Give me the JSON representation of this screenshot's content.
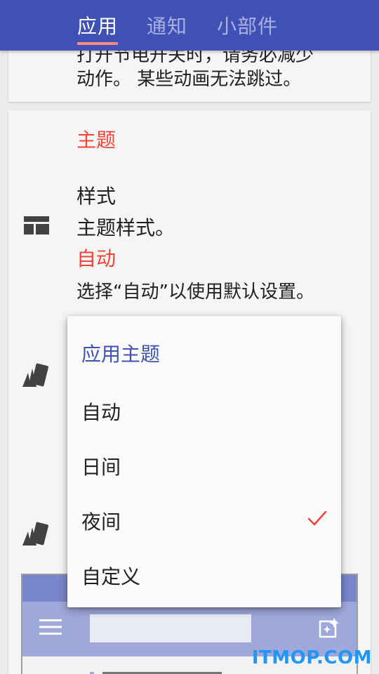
{
  "tabs": [
    {
      "label": "应用",
      "active": true
    },
    {
      "label": "通知",
      "active": false
    },
    {
      "label": "小部件",
      "active": false
    }
  ],
  "animation_card": {
    "desc_line1": "打开节电开关时，请务必减少",
    "desc_line2": "动作。 某些动画无法跳过。"
  },
  "theme_section": {
    "header": "主题",
    "style_title": "样式",
    "style_desc": "主题样式。",
    "style_value": "自动",
    "style_hint": "选择“自动”以使用默认设置。"
  },
  "menu": {
    "title": "应用主题",
    "items": [
      {
        "label": "自动",
        "checked": false
      },
      {
        "label": "日间",
        "checked": false
      },
      {
        "label": "夜间",
        "checked": true
      },
      {
        "label": "自定义",
        "checked": false
      }
    ]
  },
  "icons": {
    "style": "dashboard-layout-icon",
    "theme": "palette-cards-icon",
    "check": "check-icon",
    "preview_menu": "hamburger-menu-icon",
    "preview_action": "image-sparkle-icon"
  },
  "colors": {
    "primary": "#3f51b5",
    "accent": "#f44336",
    "tab_indicator": "#ff8a80",
    "preview_light": "#9fa8da"
  },
  "watermark": "ITMOP.COM"
}
